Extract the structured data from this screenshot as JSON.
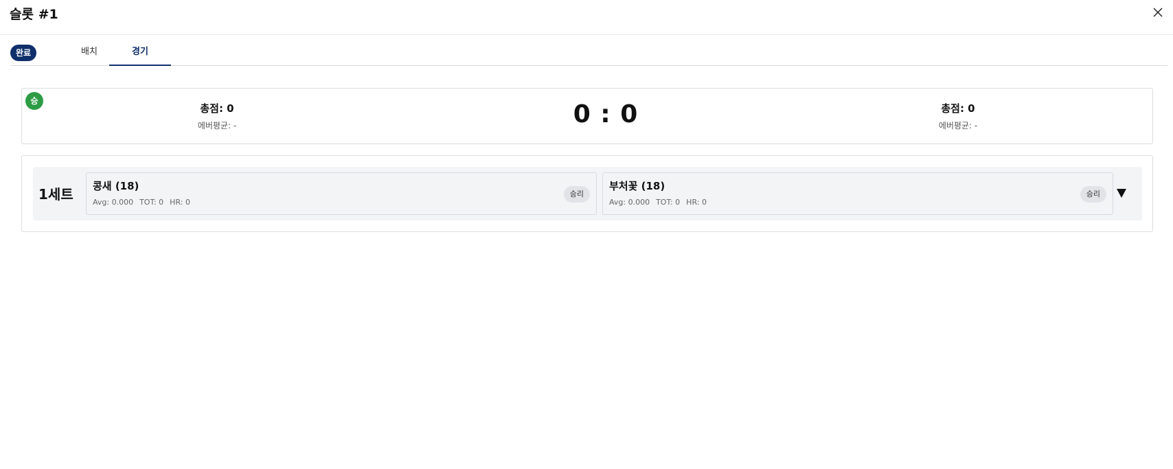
{
  "header": {
    "title": "슬롯 #1"
  },
  "tabs": {
    "status": "완료",
    "items": [
      "배치",
      "경기"
    ],
    "active": "경기"
  },
  "score": {
    "win_badge": "승",
    "left": {
      "total": "총점: 0",
      "avg": "에버평균: -"
    },
    "scoreline": "0 : 0",
    "right": {
      "total": "총점: 0",
      "avg": "에버평균: -"
    }
  },
  "sets": [
    {
      "label": "1세트",
      "players": [
        {
          "name": "콩새 (18)",
          "avg": "Avg: 0.000",
          "tot": "TOT: 0",
          "hr": "HR: 0",
          "result": "승리"
        },
        {
          "name": "부처꽃 (18)",
          "avg": "Avg: 0.000",
          "tot": "TOT: 0",
          "hr": "HR: 0",
          "result": "승리"
        }
      ]
    }
  ],
  "icons": {
    "close": "close-icon",
    "expand": "triangle-down-icon"
  },
  "colors": {
    "accent": "#0f2f6b",
    "win": "#2e9c45"
  }
}
